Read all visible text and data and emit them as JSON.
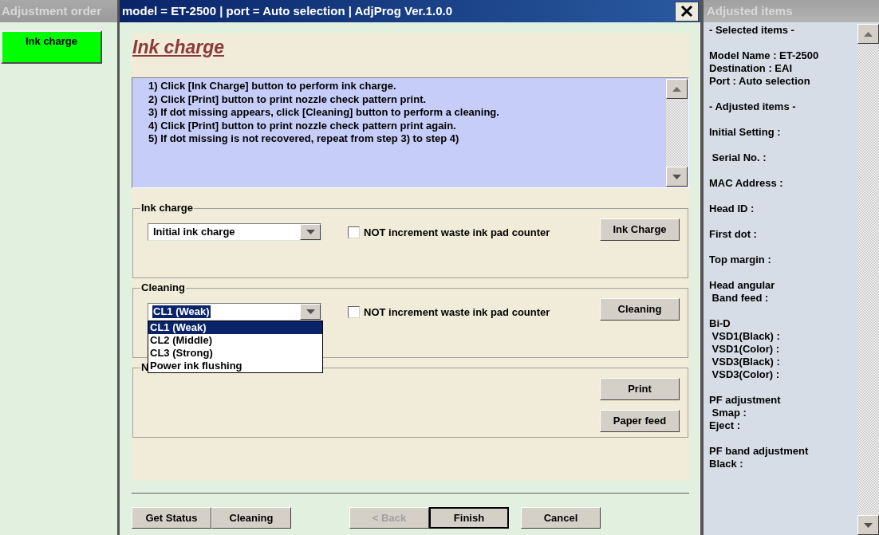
{
  "left_panel": {
    "header": "Adjustment order",
    "items": [
      {
        "label": "Ink charge",
        "selected": true
      }
    ]
  },
  "title_bar": {
    "title": "model = ET-2500 | port = Auto selection | AdjProg Ver.1.0.0"
  },
  "page": {
    "heading": "Ink charge",
    "instructions": [
      "1) Click [Ink Charge] button to perform ink charge.",
      "2) Click [Print] button to print nozzle check pattern print.",
      "3) If dot missing appears, click [Cleaning] button to perform a cleaning.",
      "4) Click [Print] button to print nozzle check pattern print again.",
      "5) If dot missing is not recovered, repeat from step 3) to step 4)"
    ]
  },
  "groups": [
    {
      "legend": "Ink charge",
      "combo": {
        "value": "Initial ink charge",
        "expanded": false
      },
      "checkbox": {
        "label": "NOT increment waste ink pad counter",
        "checked": false
      },
      "buttons": [
        "Ink Charge"
      ]
    },
    {
      "legend": "Cleaning",
      "combo": {
        "value": "CL1 (Weak)",
        "expanded": true,
        "options": [
          {
            "label": "CL1 (Weak)",
            "selected": true
          },
          {
            "label": "CL2 (Middle)",
            "selected": false
          },
          {
            "label": "CL3 (Strong)",
            "selected": false
          },
          {
            "label": "Power ink flushing",
            "selected": false
          }
        ]
      },
      "checkbox": {
        "label": "NOT increment waste ink pad counter",
        "checked": false
      },
      "buttons": [
        "Cleaning"
      ]
    },
    {
      "legend": "N",
      "buttons": [
        "Print",
        "Paper feed"
      ]
    }
  ],
  "bottom_buttons": [
    {
      "label": "Get Status",
      "disabled": false,
      "default": false
    },
    {
      "label": "Cleaning",
      "disabled": false,
      "default": false
    },
    {
      "label": "< Back",
      "disabled": true,
      "default": false
    },
    {
      "label": "Finish",
      "disabled": false,
      "default": true
    },
    {
      "label": "Cancel",
      "disabled": false,
      "default": false
    }
  ],
  "right_panel": {
    "header": "Adjusted items",
    "sections": [
      [
        "- Selected items -"
      ],
      [
        "Model Name : ET-2500",
        "Destination : EAI",
        "Port : Auto selection"
      ],
      [
        "- Adjusted items -"
      ],
      [
        "Initial Setting :"
      ],
      [
        " Serial No. :"
      ],
      [
        "MAC Address :"
      ],
      [
        "Head ID :"
      ],
      [
        "First dot :"
      ],
      [
        "Top margin :"
      ],
      [
        "Head angular",
        " Band feed :"
      ],
      [
        "Bi-D",
        " VSD1(Black) :",
        " VSD1(Color) :",
        " VSD3(Black) :",
        " VSD3(Color) :"
      ],
      [
        "PF adjustment",
        " Smap :",
        "Eject :"
      ],
      [
        "PF band adjustment",
        "Black :"
      ]
    ]
  }
}
